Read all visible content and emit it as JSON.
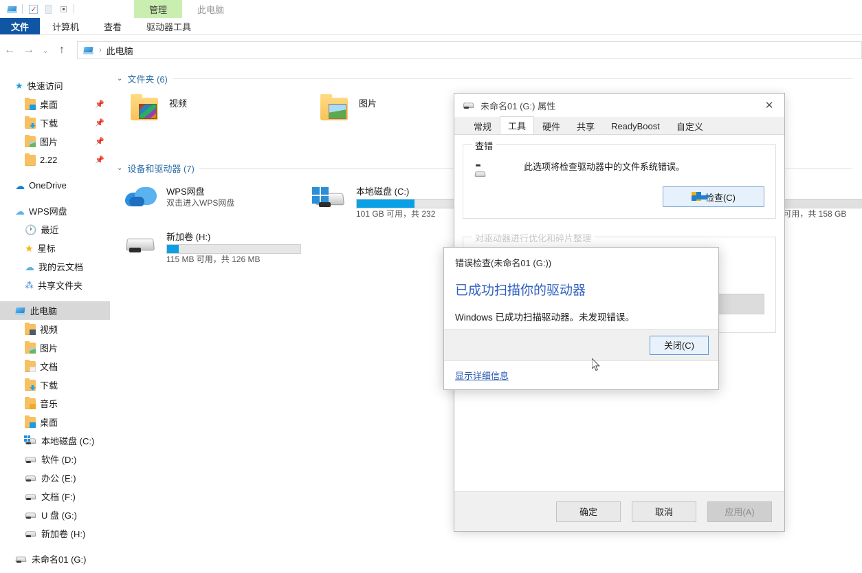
{
  "window": {
    "quick_access_icons": [
      "this-pc-icon",
      "properties-icon",
      "new-folder-icon",
      "customize-icon"
    ],
    "contextual_tab_group": "管理",
    "window_title": "此电脑",
    "ribbon_tabs": [
      {
        "label": "文件",
        "type": "file"
      },
      {
        "label": "计算机",
        "type": "normal"
      },
      {
        "label": "查看",
        "type": "normal"
      },
      {
        "label": "驱动器工具",
        "type": "contextual"
      }
    ],
    "address": {
      "back_icon": "back-arrow-icon",
      "forward_icon": "forward-arrow-icon",
      "recent_icon": "chevron-down-icon",
      "up_icon": "up-arrow-icon",
      "crumb_icon": "this-pc-icon",
      "crumb": "此电脑",
      "separator": "›"
    }
  },
  "sidebar": {
    "items": [
      {
        "label": "快速访问",
        "icon": "pin-star-icon",
        "level": 0,
        "pinned": false
      },
      {
        "label": "桌面",
        "icon": "folder-desktop-icon",
        "level": 1,
        "pinned": true
      },
      {
        "label": "下载",
        "icon": "folder-downloads-icon",
        "level": 1,
        "pinned": true
      },
      {
        "label": "图片",
        "icon": "folder-pictures-icon",
        "level": 1,
        "pinned": true
      },
      {
        "label": "2.22",
        "icon": "folder-icon",
        "level": 1,
        "pinned": true
      },
      {
        "label": "OneDrive",
        "icon": "onedrive-cloud-icon",
        "level": 0,
        "pinned": false
      },
      {
        "label": "WPS网盘",
        "icon": "wps-cloud-icon",
        "level": 0,
        "pinned": false
      },
      {
        "label": "最近",
        "icon": "clock-icon",
        "level": 1,
        "pinned": false
      },
      {
        "label": "星标",
        "icon": "star-icon",
        "level": 1,
        "pinned": false
      },
      {
        "label": "我的云文档",
        "icon": "cloud-doc-icon",
        "level": 1,
        "pinned": false
      },
      {
        "label": "共享文件夹",
        "icon": "share-icon",
        "level": 1,
        "pinned": false
      },
      {
        "label": "此电脑",
        "icon": "this-pc-icon",
        "level": 0,
        "pinned": false,
        "selected": true
      },
      {
        "label": "视频",
        "icon": "folder-videos-icon",
        "level": 1,
        "pinned": false
      },
      {
        "label": "图片",
        "icon": "folder-pictures-icon",
        "level": 1,
        "pinned": false
      },
      {
        "label": "文档",
        "icon": "folder-documents-icon",
        "level": 1,
        "pinned": false
      },
      {
        "label": "下载",
        "icon": "folder-downloads-icon",
        "level": 1,
        "pinned": false
      },
      {
        "label": "音乐",
        "icon": "folder-music-icon",
        "level": 1,
        "pinned": false
      },
      {
        "label": "桌面",
        "icon": "folder-desktop-icon",
        "level": 1,
        "pinned": false
      },
      {
        "label": "本地磁盘 (C:)",
        "icon": "windows-drive-icon",
        "level": 1,
        "pinned": false
      },
      {
        "label": "软件 (D:)",
        "icon": "drive-icon",
        "level": 1,
        "pinned": false
      },
      {
        "label": "办公 (E:)",
        "icon": "drive-icon",
        "level": 1,
        "pinned": false
      },
      {
        "label": "文档 (F:)",
        "icon": "drive-icon",
        "level": 1,
        "pinned": false
      },
      {
        "label": "U 盘 (G:)",
        "icon": "drive-icon",
        "level": 1,
        "pinned": false
      },
      {
        "label": "新加卷 (H:)",
        "icon": "drive-icon",
        "level": 1,
        "pinned": false
      },
      {
        "label": "未命名01 (G:)",
        "icon": "drive-icon",
        "level": 0,
        "pinned": false
      }
    ]
  },
  "content": {
    "groups": [
      {
        "title": "文件夹 (6)",
        "chevron": "chevron-down-icon"
      },
      {
        "title": "设备和驱动器 (7)",
        "chevron": "chevron-down-icon"
      }
    ],
    "folders": [
      {
        "label": "视频",
        "icon": "folder-videos-icon"
      },
      {
        "label": "图片",
        "icon": "folder-pictures-icon"
      }
    ],
    "drives": [
      {
        "label": "WPS网盘",
        "sub": "双击进入WPS网盘",
        "icon": "wps-cloud-icon",
        "has_bar": false
      },
      {
        "label": "本地磁盘 (C:)",
        "sub": "101 GB 可用，共 232",
        "icon": "windows-drive-icon",
        "has_bar": true,
        "fill_percent": 57
      },
      {
        "label": "新加卷 (H:)",
        "sub": "115 MB 可用，共 126 MB",
        "icon": "drive-icon",
        "has_bar": true,
        "fill_percent": 9
      },
      {
        "label": ":)",
        "sub": "B 可用，共 158 GB",
        "icon": "drive-icon",
        "has_bar": true,
        "fill_percent": 0,
        "occluded": true
      }
    ]
  },
  "properties_dialog": {
    "title": "未命名01 (G:) 属性",
    "title_icon": "drive-icon",
    "close_icon": "close-icon",
    "tabs": [
      {
        "label": "常规",
        "active": false
      },
      {
        "label": "工具",
        "active": true
      },
      {
        "label": "硬件",
        "active": false
      },
      {
        "label": "共享",
        "active": false
      },
      {
        "label": "ReadyBoost",
        "active": false
      },
      {
        "label": "自定义",
        "active": false
      }
    ],
    "error_check_group": {
      "title": "查错",
      "icon": "drive-icon",
      "description": "此选项将检查驱动器中的文件系统错误。",
      "button_label": "检查(C)",
      "button_icon": "uac-shield-icon"
    },
    "optimize_group": {
      "title": "对驱动器进行优化和碎片整理"
    },
    "footer_buttons": [
      {
        "label": "确定",
        "disabled": false
      },
      {
        "label": "取消",
        "disabled": false
      },
      {
        "label": "应用(A)",
        "disabled": true
      }
    ]
  },
  "error_check_dialog": {
    "title": "错误检查(未命名01 (G:))",
    "heading": "已成功扫描你的驱动器",
    "message": "Windows 已成功扫描驱动器。未发现错误。",
    "close_button": "关闭(C)",
    "details_link": "显示详细信息"
  },
  "colors": {
    "accent_blue": "#0078d7",
    "file_tab_blue": "#0f56a4",
    "contextual_green": "#c9eeb0",
    "group_header_blue": "#2f6fa8",
    "heading_blue": "#2f5fbf",
    "link_blue": "#2a5bb5",
    "bar_fill": "#0aa0e6",
    "selection": "#cfe4f7"
  }
}
